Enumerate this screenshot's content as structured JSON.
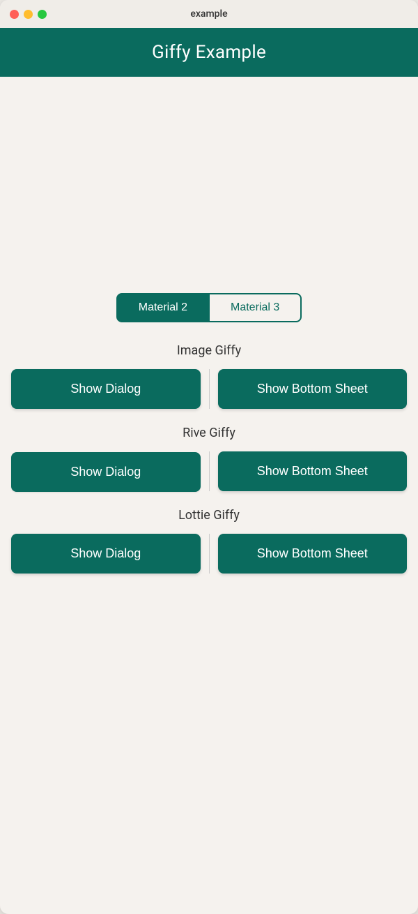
{
  "window": {
    "title": "example"
  },
  "header": {
    "title": "Giffy Example"
  },
  "tabs": [
    {
      "id": "material2",
      "label": "Material 2",
      "active": true
    },
    {
      "id": "material3",
      "label": "Material 3",
      "active": false
    }
  ],
  "sections": [
    {
      "id": "image-giffy",
      "title": "Image Giffy",
      "showDialogLabel": "Show Dialog",
      "showBottomSheetLabel": "Show Bottom Sheet"
    },
    {
      "id": "rive-giffy",
      "title": "Rive Giffy",
      "showDialogLabel": "Show Dialog",
      "showBottomSheetLabel": "Show Bottom Sheet"
    },
    {
      "id": "lottie-giffy",
      "title": "Lottie Giffy",
      "showDialogLabel": "Show Dialog",
      "showBottomSheetLabel": "Show Bottom Sheet"
    }
  ]
}
